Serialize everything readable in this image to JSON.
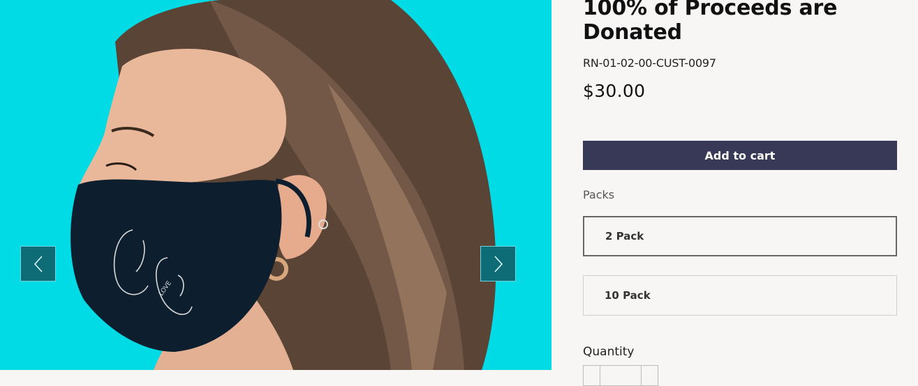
{
  "product": {
    "title": "100% of Proceeds are Donated",
    "sku": "RN-01-02-00-CUST-0097",
    "price": "$30.00",
    "add_to_cart_label": "Add to cart"
  },
  "packs": {
    "label": "Packs",
    "options": [
      {
        "label": "2 Pack",
        "selected": true
      },
      {
        "label": "10 Pack",
        "selected": false
      }
    ]
  },
  "quantity": {
    "label": "Quantity"
  },
  "gallery": {
    "prev_icon": "chevron-left-icon",
    "next_icon": "chevron-right-icon",
    "image_subject": "woman-wearing-face-mask",
    "mask_print_text": "LOVE"
  },
  "colors": {
    "background": "#f7f6f4",
    "gallery_background": "#00dbe5",
    "button": "#373956",
    "slider_button": "#0e6c76"
  }
}
